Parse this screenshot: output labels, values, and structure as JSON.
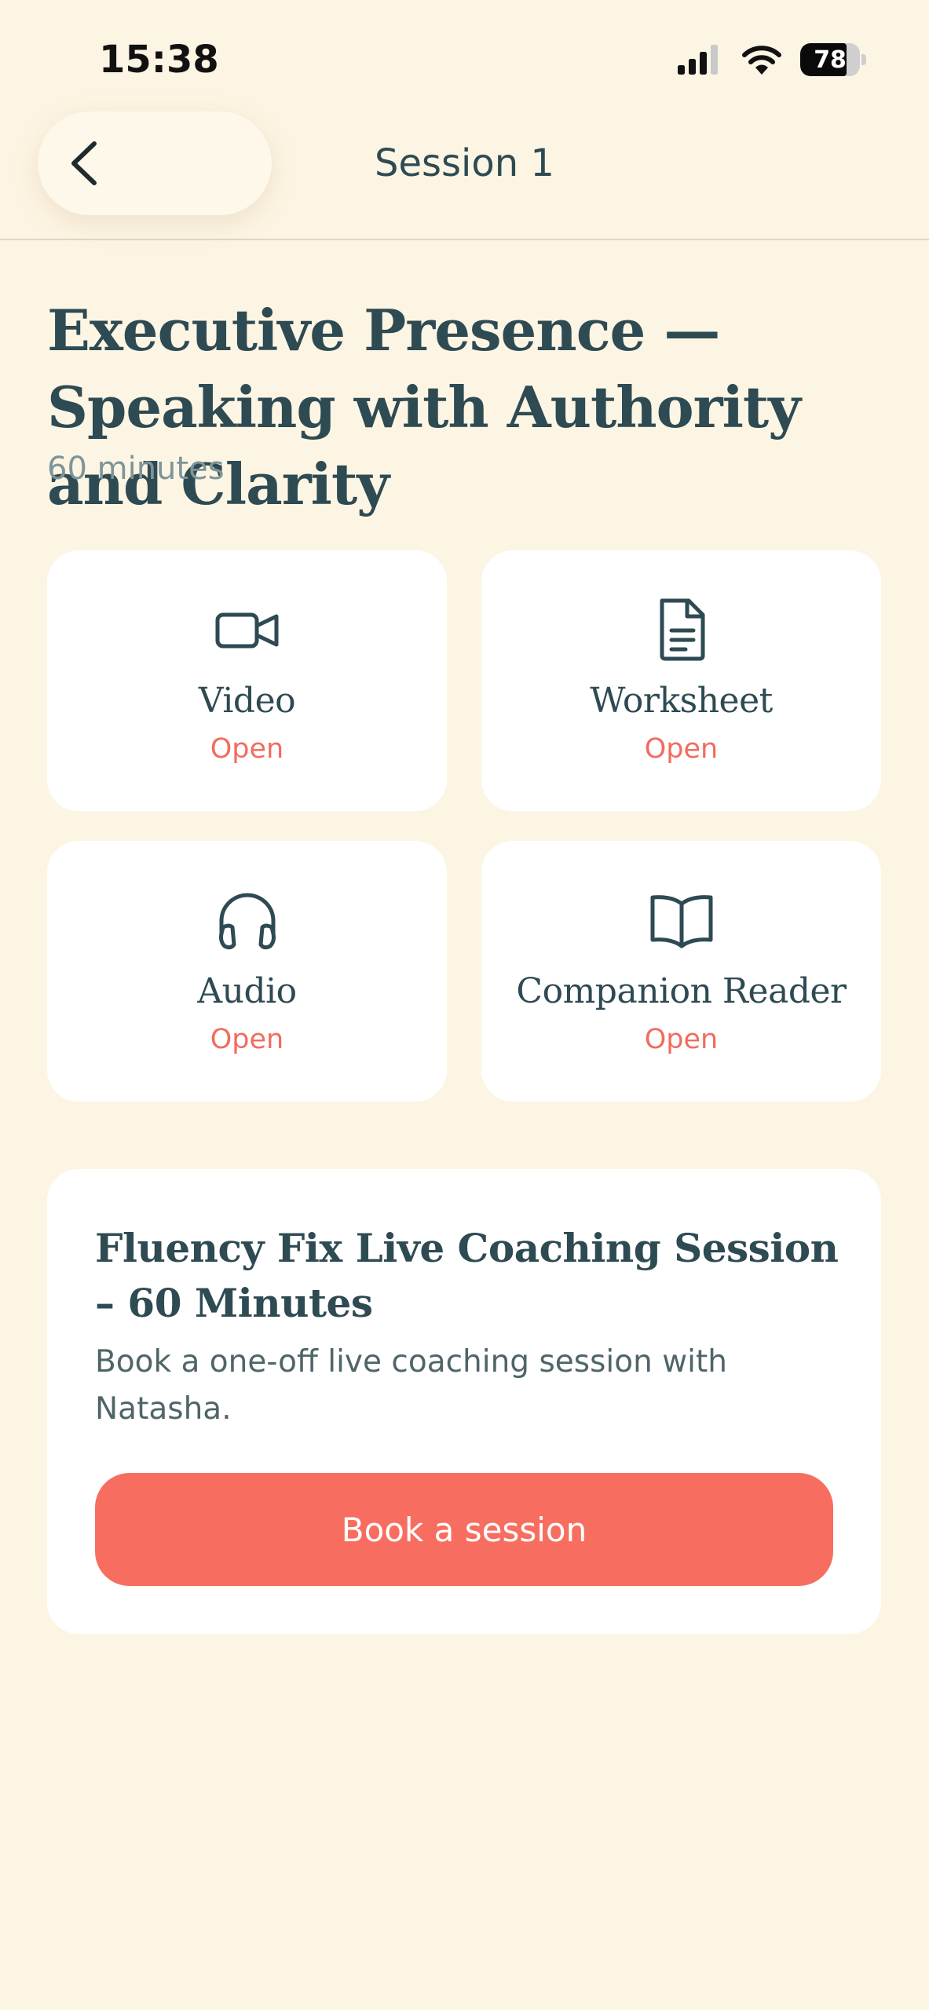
{
  "status_bar": {
    "time": "15:38",
    "battery_level": "78",
    "battery_fraction": 0.78
  },
  "header": {
    "title": "Session 1",
    "back_icon": "chevron-left-icon"
  },
  "session": {
    "title": "Executive Presence — Speaking with Authority and Clarity",
    "duration": "60 minutes"
  },
  "resources": [
    {
      "label": "Video",
      "action": "Open",
      "icon": "video-camera-icon"
    },
    {
      "label": "Worksheet",
      "action": "Open",
      "icon": "document-icon"
    },
    {
      "label": "Audio",
      "action": "Open",
      "icon": "headphones-icon"
    },
    {
      "label": "Companion Reader",
      "action": "Open",
      "icon": "open-book-icon"
    }
  ],
  "coaching": {
    "title": "Fluency Fix Live Coaching Session – 60 Minutes",
    "description": "Book a one-off live coaching session with Natasha.",
    "button_label": "Book a session"
  },
  "colors": {
    "background": "#FDF5E4",
    "card": "#FFFFFF",
    "text_primary": "#2E4A52",
    "text_muted": "#7E9598",
    "accent": "#F26C5F",
    "button": "#F76E60"
  }
}
